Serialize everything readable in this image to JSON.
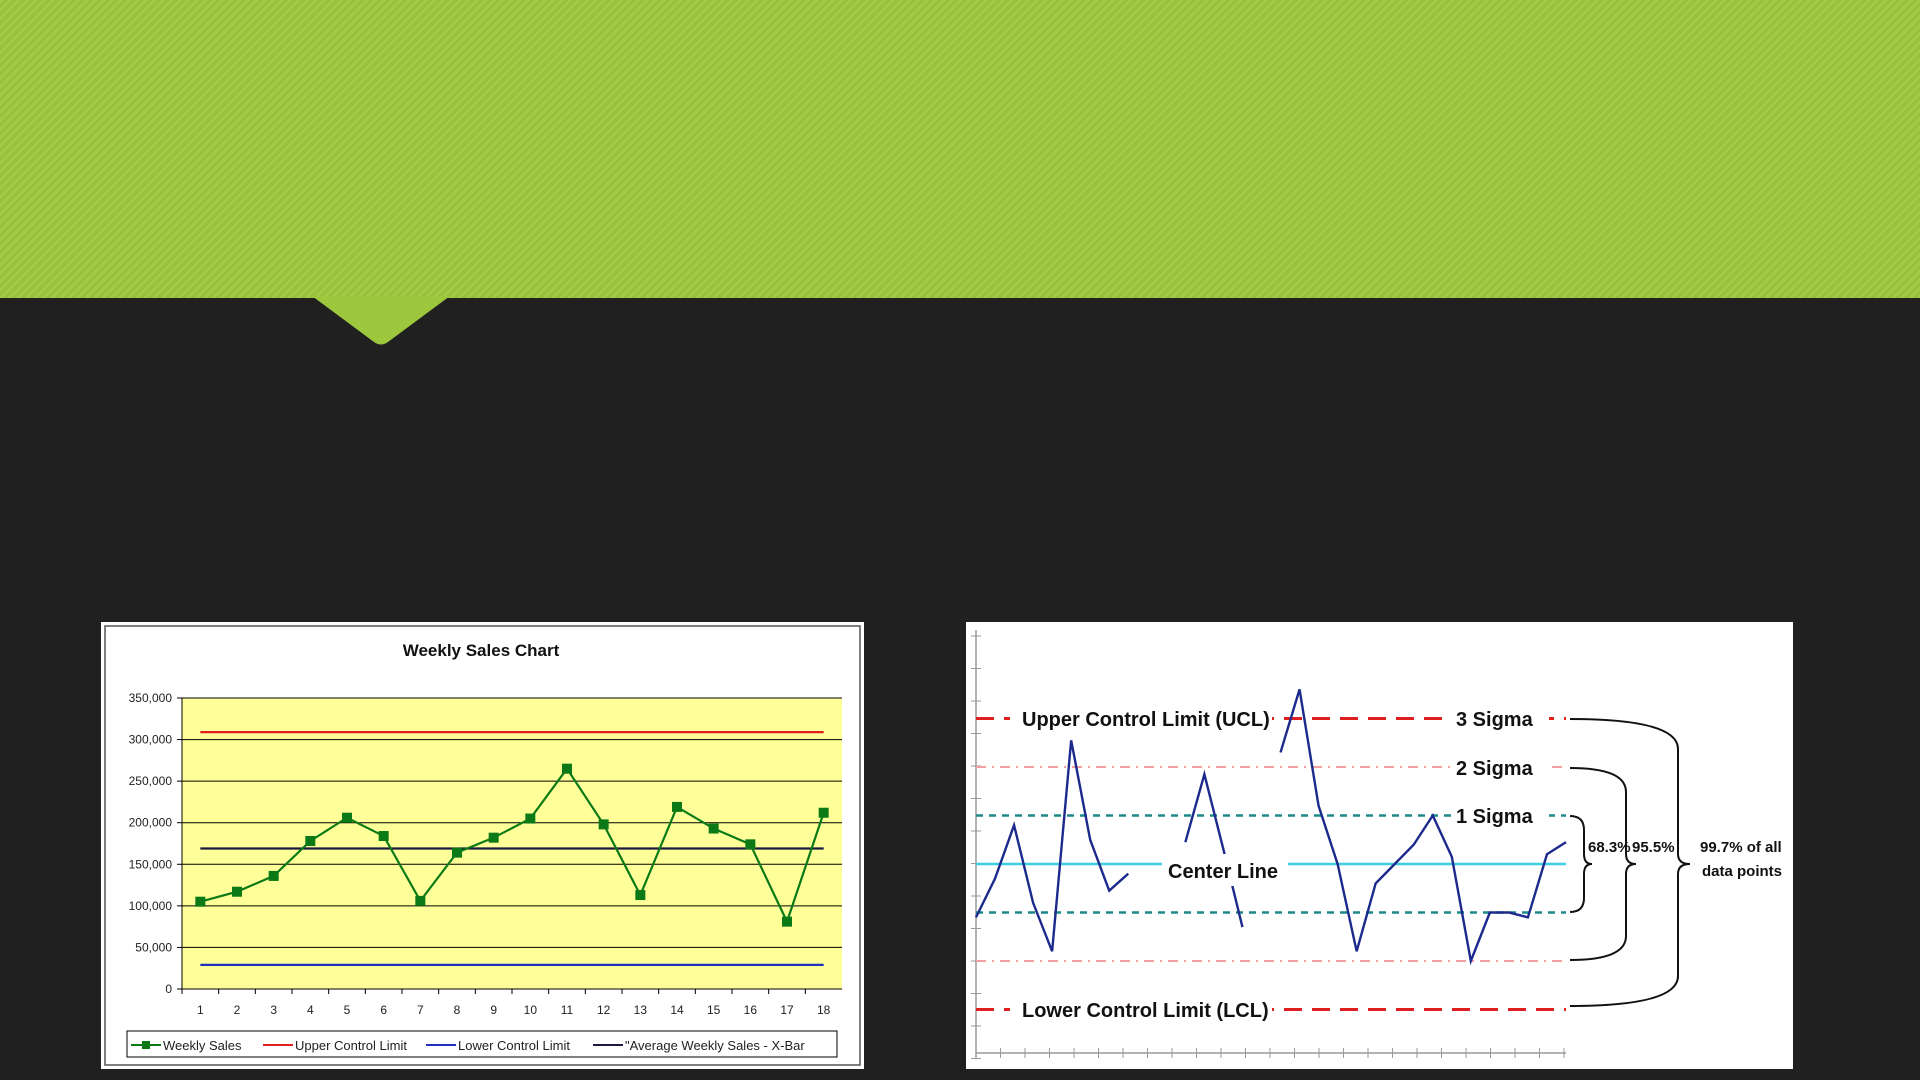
{
  "slide": {
    "banner_color": "#9dc73d",
    "background_color": "#202020"
  },
  "chart_data": [
    {
      "type": "line",
      "title": "Weekly Sales Chart",
      "categories": [
        "1",
        "2",
        "3",
        "4",
        "5",
        "6",
        "7",
        "8",
        "9",
        "10",
        "11",
        "12",
        "13",
        "14",
        "15",
        "16",
        "17",
        "18"
      ],
      "yticks": [
        "0",
        "50,000",
        "100,000",
        "150,000",
        "200,000",
        "250,000",
        "300,000",
        "350,000"
      ],
      "ylim": [
        0,
        350000
      ],
      "grid": true,
      "plot_background": "#ffff99",
      "legend_position": "bottom",
      "series": [
        {
          "name": "Weekly Sales",
          "color": "#0b7a16",
          "values": [
            105000,
            117000,
            136000,
            178000,
            206000,
            184000,
            106000,
            164000,
            182000,
            205000,
            265000,
            198000,
            113000,
            219000,
            193000,
            174000,
            81000,
            212000
          ]
        },
        {
          "name": "Upper Control Limit",
          "color": "#e02020",
          "values": [
            309000,
            309000,
            309000,
            309000,
            309000,
            309000,
            309000,
            309000,
            309000,
            309000,
            309000,
            309000,
            309000,
            309000,
            309000,
            309000,
            309000,
            309000
          ]
        },
        {
          "name": "Lower Control Limit",
          "color": "#2030c0",
          "values": [
            29000,
            29000,
            29000,
            29000,
            29000,
            29000,
            29000,
            29000,
            29000,
            29000,
            29000,
            29000,
            29000,
            29000,
            29000,
            29000,
            29000,
            29000
          ]
        },
        {
          "name": "\"Average Weekly Sales - X-Bar",
          "color": "#1a1a40",
          "values": [
            169000,
            169000,
            169000,
            169000,
            169000,
            169000,
            169000,
            169000,
            169000,
            169000,
            169000,
            169000,
            169000,
            169000,
            169000,
            169000,
            169000,
            169000
          ]
        }
      ]
    },
    {
      "type": "line",
      "labels": {
        "ucl": "Upper Control Limit (UCL)",
        "lcl": "Lower Control Limit (LCL)",
        "center": "Center Line",
        "sigma3": "3 Sigma",
        "sigma2": "2 Sigma",
        "sigma1": "1 Sigma",
        "pct1": "68.3%",
        "pct2": "95.5%",
        "pct3a": "99.7% of all",
        "pct3b": "data points"
      },
      "levels_sigma": {
        "ucl": 3,
        "two": 2,
        "one": 1,
        "center": 0,
        "minus_one": -1,
        "minus_two": -2,
        "lcl": -3
      },
      "colors": {
        "series": "#1b2a8c",
        "limits": "#e02020",
        "two_sigma": "#f2a0a0",
        "one_sigma": "#1a8a8a",
        "center": "#3ccfe0"
      },
      "series_sigma": [
        -1.1,
        -0.3,
        0.8,
        -0.8,
        -1.8,
        2.55,
        0.5,
        -0.55,
        -0.2,
        null,
        null,
        0.45,
        1.85,
        0.3,
        -1.3,
        null,
        2.3,
        3.6,
        1.2,
        0,
        -1.8,
        -0.4,
        0,
        0.4,
        1.0,
        0.15,
        -2.0,
        -1.0,
        -1.0,
        -1.1,
        0.2,
        0.45
      ]
    }
  ]
}
